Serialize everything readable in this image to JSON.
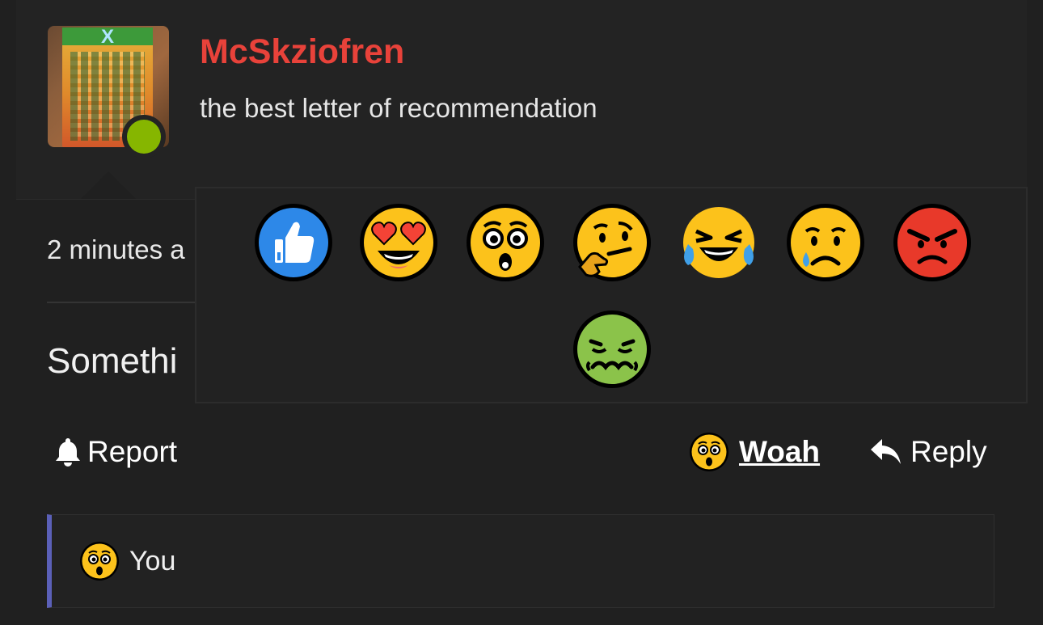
{
  "post": {
    "username": "McSkziofren",
    "subtitle": "the best letter of recommendation",
    "time": "2 minutes a",
    "text": "Somethi"
  },
  "actions": {
    "report_label": "Report",
    "reaction_label": "Woah",
    "reply_label": "Reply"
  },
  "reactions_list": {
    "user": "You"
  },
  "reaction_picker": {
    "options": [
      "like",
      "love",
      "woah",
      "hmm",
      "haha",
      "sad",
      "angry",
      "sick"
    ]
  },
  "colors": {
    "username": "#e8423a",
    "online": "#86b600",
    "quote_bar": "#5b60b8"
  }
}
